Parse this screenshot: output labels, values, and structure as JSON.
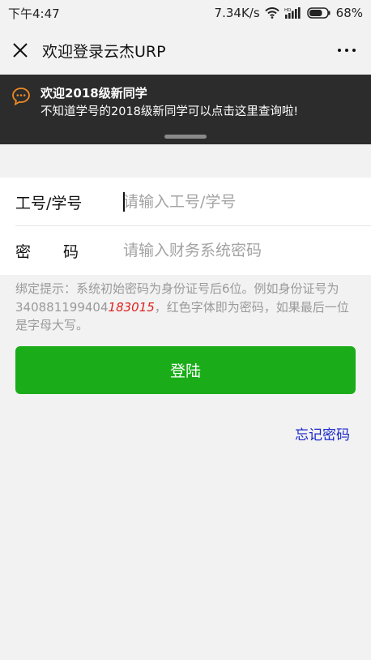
{
  "status_bar": {
    "time": "下午4:47",
    "network_speed": "7.34K/s",
    "signal_label": "HD",
    "battery": "68%"
  },
  "title_bar": {
    "close_icon": "close-icon",
    "title": "欢迎登录云杰URP",
    "more_icon": "more-icon"
  },
  "banner": {
    "icon": "chat-bubble-icon",
    "title": "欢迎2018级新同学",
    "subtitle": "不知道学号的2018级新同学可以点击这里查询啦!"
  },
  "form": {
    "id_label": "工号/学号",
    "id_value": "",
    "id_placeholder": "请输入工号/学号",
    "password_label": "密码",
    "password_value": "",
    "password_placeholder": "请输入财务系统密码"
  },
  "hint": {
    "prefix": "绑定提示：系统初始密码为身份证号后6位。例如身份证号为340881199404",
    "highlight": "183015",
    "suffix": "，红色字体即为密码，如果最后一位是字母大写。"
  },
  "actions": {
    "login_label": "登陆",
    "forgot_label": "忘记密码"
  },
  "colors": {
    "primary_green": "#1aad19",
    "banner_bg": "#2c2c2c",
    "link_blue": "#1a27c9",
    "highlight_red": "#e02020"
  }
}
